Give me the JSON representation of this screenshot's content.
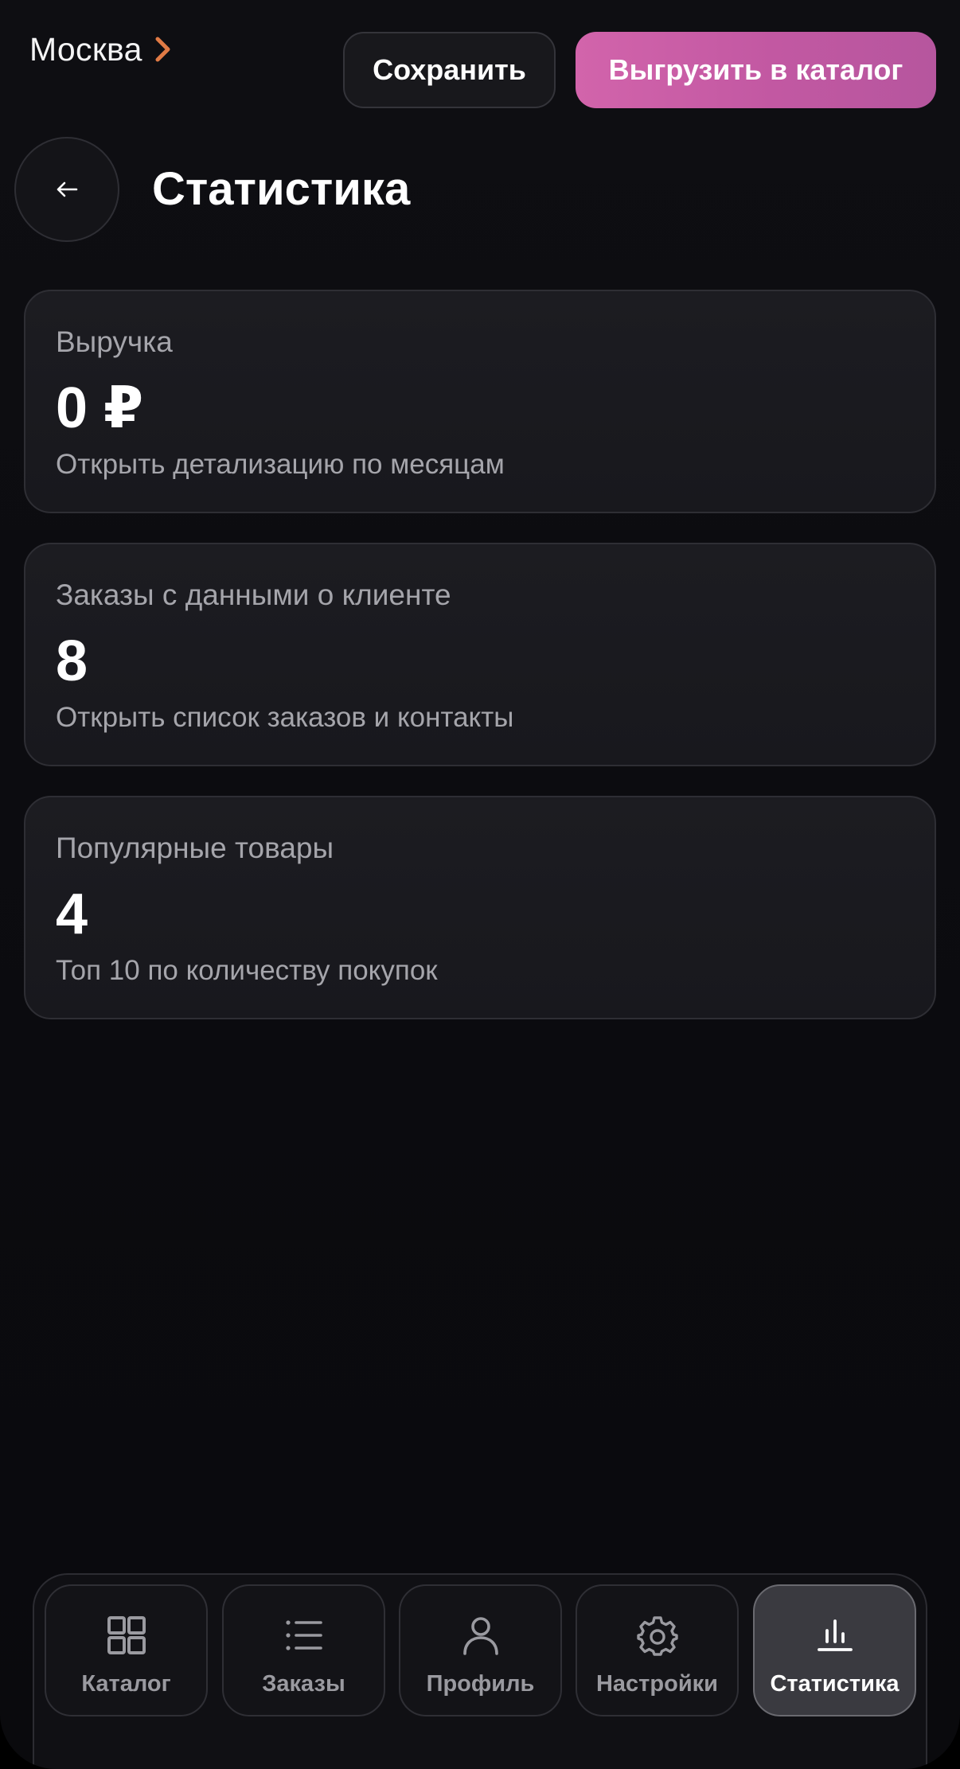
{
  "header": {
    "city": "Москва",
    "save_label": "Сохранить",
    "export_label": "Выгрузить в каталог"
  },
  "page": {
    "title": "Статистика"
  },
  "cards": [
    {
      "label": "Выручка",
      "value": "0 ₽",
      "subtitle": "Открыть детализацию по месяцам"
    },
    {
      "label": "Заказы с данными о клиенте",
      "value": "8",
      "subtitle": "Открыть список заказов и контакты"
    },
    {
      "label": "Популярные товары",
      "value": "4",
      "subtitle": "Топ 10 по количеству покупок"
    }
  ],
  "nav": {
    "items": [
      {
        "label": "Каталог",
        "icon": "grid-icon"
      },
      {
        "label": "Заказы",
        "icon": "list-icon"
      },
      {
        "label": "Профиль",
        "icon": "user-icon"
      },
      {
        "label": "Настройки",
        "icon": "gear-icon"
      },
      {
        "label": "Статистика",
        "icon": "bar-chart-icon",
        "active": true
      }
    ]
  },
  "colors": {
    "accent": "#cc5fa6",
    "city_chevron": "#e07a45",
    "background": "#0d0d11"
  }
}
